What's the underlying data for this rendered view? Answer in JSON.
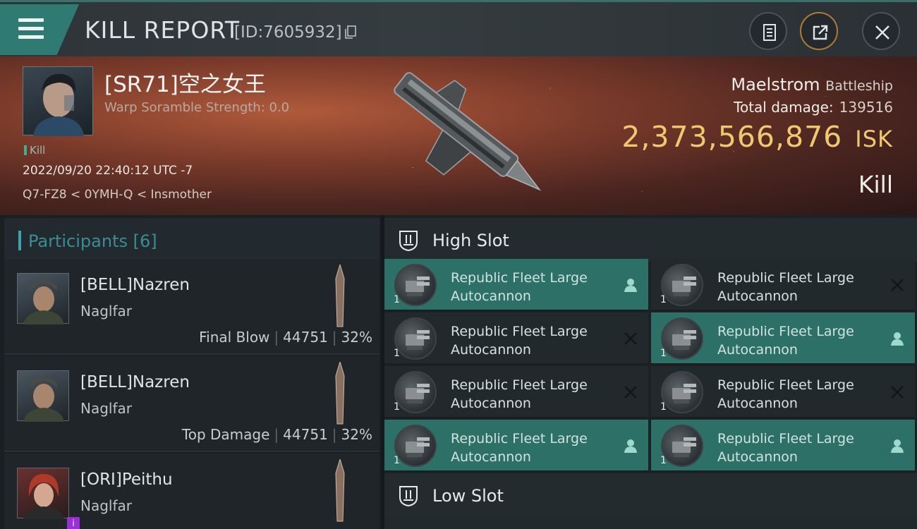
{
  "titlebar": {
    "title": "KILL REPORT",
    "report_id": "[ID:7605932]"
  },
  "victim": {
    "pilot": "[SR71]空之女王",
    "warp_scramble": "Warp Soramble Strength: 0.0",
    "tag": "Kill",
    "datetime": "2022/09/20 22:40:12 UTC -7",
    "location": "Q7-FZ8 < 0YMH-Q < Insmother",
    "ship_name": "Maelstrom",
    "ship_class": "Battleship",
    "total_damage_label": "Total damage:",
    "total_damage": "139516",
    "isk_value": "2,373,566,876",
    "isk_unit": "ISK",
    "result": "Kill"
  },
  "participants": {
    "header": "Participants [6]",
    "items": [
      {
        "name": "[BELL]Nazren",
        "ship": "Naglfar",
        "role": "Final Blow",
        "damage": "44751",
        "percent": "32%"
      },
      {
        "name": "[BELL]Nazren",
        "ship": "Naglfar",
        "role": "Top Damage",
        "damage": "44751",
        "percent": "32%"
      },
      {
        "name": "[ORI]Peithu",
        "ship": "Naglfar",
        "role": "",
        "damage": "",
        "percent": ""
      }
    ]
  },
  "slots": {
    "high_label": "High Slot",
    "low_label": "Low Slot",
    "high_modules": [
      {
        "line1": "Republic Fleet Large",
        "line2": "Autocannon",
        "qty": "1",
        "state": "dropped"
      },
      {
        "line1": "Republic Fleet Large",
        "line2": "Autocannon",
        "qty": "1",
        "state": "destroyed"
      },
      {
        "line1": "Republic Fleet Large",
        "line2": "Autocannon",
        "qty": "1",
        "state": "destroyed"
      },
      {
        "line1": "Republic Fleet Large",
        "line2": "Autocannon",
        "qty": "1",
        "state": "dropped"
      },
      {
        "line1": "Republic Fleet Large",
        "line2": "Autocannon",
        "qty": "1",
        "state": "destroyed"
      },
      {
        "line1": "Republic Fleet Large",
        "line2": "Autocannon",
        "qty": "1",
        "state": "destroyed"
      },
      {
        "line1": "Republic Fleet Large",
        "line2": "Autocannon",
        "qty": "1",
        "state": "dropped"
      },
      {
        "line1": "Republic Fleet Large",
        "line2": "Autocannon",
        "qty": "1",
        "state": "dropped"
      }
    ]
  },
  "colors": {
    "accent_teal": "#2d7068",
    "isk_gold": "#f0c870"
  }
}
